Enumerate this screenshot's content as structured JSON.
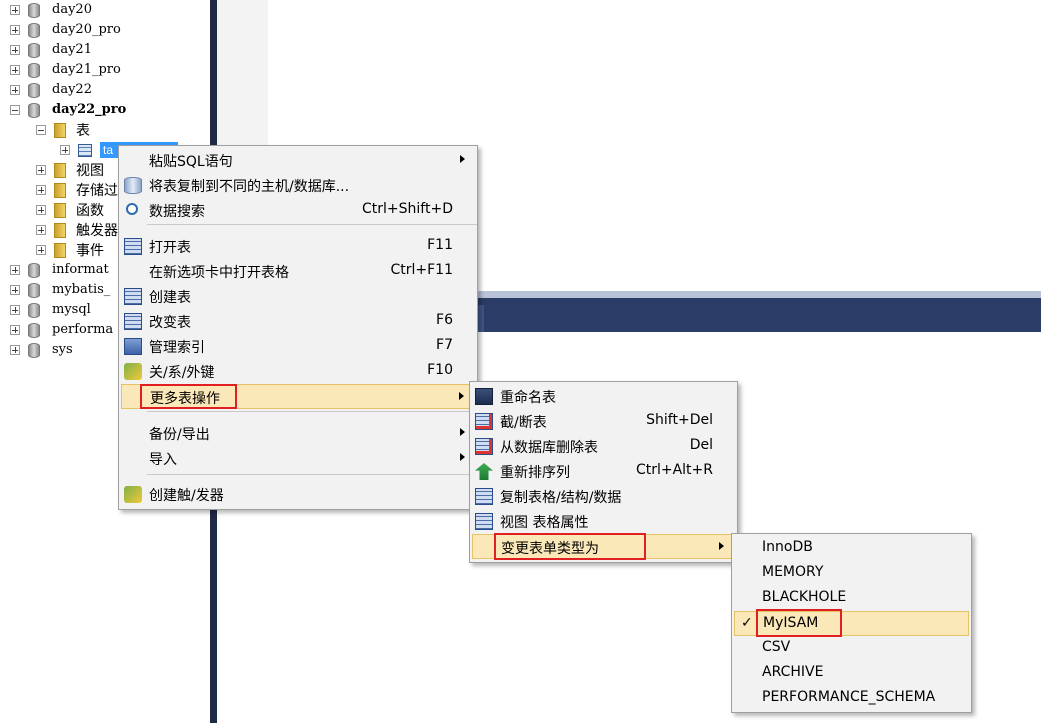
{
  "tree": {
    "nodes": [
      {
        "label": "day20",
        "expander": "plus",
        "icon": "database-icon"
      },
      {
        "label": "day20_pro",
        "expander": "plus",
        "icon": "database-icon"
      },
      {
        "label": "day21",
        "expander": "plus",
        "icon": "database-icon"
      },
      {
        "label": "day21_pro",
        "expander": "plus",
        "icon": "database-icon"
      },
      {
        "label": "day22",
        "expander": "plus",
        "icon": "database-icon"
      },
      {
        "label": "day22_pro",
        "expander": "minus",
        "icon": "database-icon",
        "bold": true
      },
      {
        "label": "表",
        "expander": "minus",
        "icon": "folder-icon"
      },
      {
        "label": "ta",
        "expander": "plus",
        "icon": "table-icon",
        "selected": true
      },
      {
        "label": "视图",
        "expander": "plus",
        "icon": "folder-icon"
      },
      {
        "label": "存储过",
        "expander": "plus",
        "icon": "folder-icon"
      },
      {
        "label": "函数",
        "expander": "plus",
        "icon": "folder-icon"
      },
      {
        "label": "触发器",
        "expander": "plus",
        "icon": "folder-icon"
      },
      {
        "label": "事件",
        "expander": "plus",
        "icon": "folder-icon"
      },
      {
        "label": "informat",
        "expander": "plus",
        "icon": "database-icon"
      },
      {
        "label": "mybatis_",
        "expander": "plus",
        "icon": "database-icon"
      },
      {
        "label": "mysql",
        "expander": "plus",
        "icon": "database-icon"
      },
      {
        "label": "performa",
        "expander": "plus",
        "icon": "database-icon"
      },
      {
        "label": "sys",
        "expander": "plus",
        "icon": "database-icon"
      }
    ]
  },
  "context_menu": {
    "items": [
      {
        "label": "粘贴SQL语句",
        "shortcut": "",
        "submenu": true,
        "icon": ""
      },
      {
        "label": "将表复制到不同的主机/数据库...",
        "shortcut": "",
        "icon": "copy-to-host-icon"
      },
      {
        "label": "数据搜索",
        "shortcut": "Ctrl+Shift+D",
        "icon": "search-icon"
      },
      {
        "label": "打开表",
        "shortcut": "F11",
        "icon": "open-table-icon"
      },
      {
        "label": "在新选项卡中打开表格",
        "shortcut": "Ctrl+F11",
        "icon": ""
      },
      {
        "label": "创建表",
        "shortcut": "",
        "icon": "create-table-icon"
      },
      {
        "label": "改变表",
        "shortcut": "F6",
        "icon": "alter-table-icon"
      },
      {
        "label": "管理索引",
        "shortcut": "F7",
        "icon": "manage-index-icon"
      },
      {
        "label": "关/系/外键",
        "shortcut": "F10",
        "icon": "foreign-key-icon"
      },
      {
        "label": "更多表操作",
        "shortcut": "",
        "submenu": true,
        "icon": "",
        "highlighted": true
      },
      {
        "label": "备份/导出",
        "shortcut": "",
        "submenu": true,
        "icon": ""
      },
      {
        "label": "导入",
        "shortcut": "",
        "submenu": true,
        "icon": ""
      },
      {
        "label": "创建触/发器",
        "shortcut": "",
        "icon": "create-trigger-icon"
      }
    ]
  },
  "more_table_menu": {
    "items": [
      {
        "label": "重命名表",
        "shortcut": "",
        "icon": "rename-table-icon"
      },
      {
        "label": "截/断表",
        "shortcut": "Shift+Del",
        "icon": "truncate-table-icon"
      },
      {
        "label": "从数据库删除表",
        "shortcut": "Del",
        "icon": "drop-table-icon"
      },
      {
        "label": "重新排序列",
        "shortcut": "Ctrl+Alt+R",
        "icon": "reorder-columns-icon"
      },
      {
        "label": "复制表格/结构/数据",
        "shortcut": "",
        "icon": "duplicate-table-icon"
      },
      {
        "label": "视图 表格属性",
        "shortcut": "",
        "icon": "table-properties-icon"
      },
      {
        "label": "变更表单类型为",
        "shortcut": "",
        "submenu": true,
        "icon": "",
        "highlighted": true
      }
    ]
  },
  "engine_menu": {
    "items": [
      {
        "label": "InnoDB",
        "checked": false
      },
      {
        "label": "MEMORY",
        "checked": false
      },
      {
        "label": "BLACKHOLE",
        "checked": false
      },
      {
        "label": "MyISAM",
        "checked": true
      },
      {
        "label": "CSV",
        "checked": false
      },
      {
        "label": "ARCHIVE",
        "checked": false
      },
      {
        "label": "PERFORMANCE_SCHEMA",
        "checked": false
      }
    ],
    "check_mark": "✓"
  },
  "colors": {
    "selection": "#3399ff",
    "menu_bg": "#f2f2f2",
    "menu_highlight": "#fbe8b8",
    "annotation_red": "#e02020",
    "divider": "#1f2a44"
  }
}
